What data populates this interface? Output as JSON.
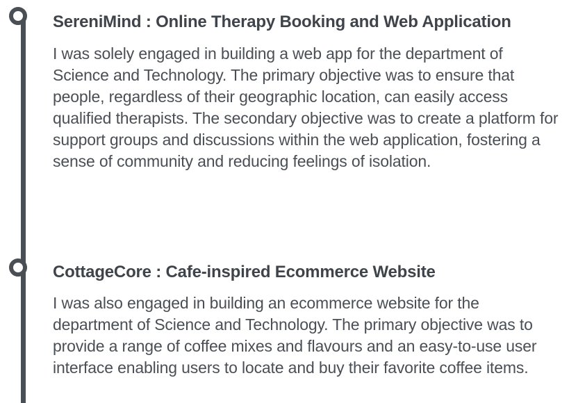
{
  "entries": [
    {
      "title": "SereniMind : Online Therapy Booking and Web Application",
      "description": "I was solely engaged in building a web app for the department of Science and Technology. The primary objective was to ensure that people, regardless of their geographic location, can easily access qualified therapists. The secondary objective was to create a platform for support groups and discussions within the web application, fostering a sense of community and reducing feelings of isolation."
    },
    {
      "title": "CottageCore : Cafe-inspired Ecommerce Website",
      "description": "I was also engaged in building an ecommerce website for the department of Science and Technology. The primary objective was to provide a range of coffee mixes and flavours and an easy-to-use user interface enabling users to locate and buy their favorite coffee items."
    }
  ],
  "colors": {
    "text": "#4a4f55",
    "timeline": "#4a4f55",
    "background": "#ffffff"
  }
}
